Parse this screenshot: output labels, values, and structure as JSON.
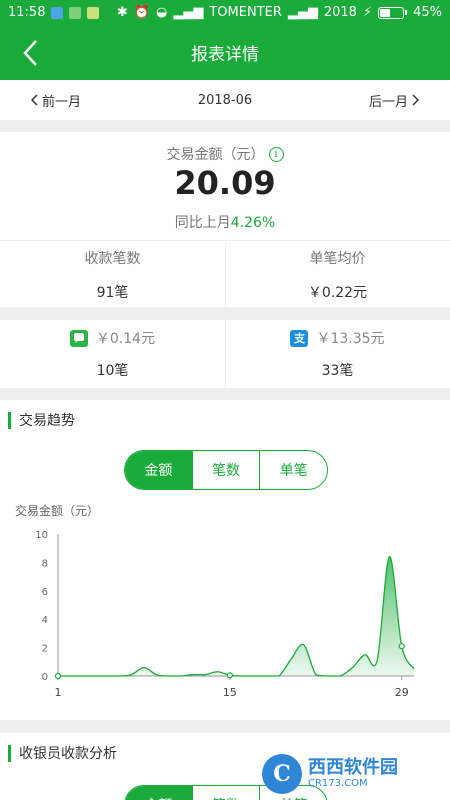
{
  "status_bar": {
    "time": "11:58",
    "carrier": "TOMENTER",
    "year_badge": "2018",
    "battery": "45%",
    "battery_level": 0.45
  },
  "header": {
    "title": "报表详情"
  },
  "month_nav": {
    "prev_label": "前一月",
    "current": "2018-06",
    "next_label": "后一月"
  },
  "summary": {
    "amount_label": "交易金额（元）",
    "amount": "20.09",
    "yoy_label": "同比上月",
    "yoy_value": "4.26%",
    "count_label": "收款笔数",
    "count_value": "91笔",
    "avg_label": "单笔均价",
    "avg_value": "￥0.22元"
  },
  "pay_split": {
    "wechat": {
      "amount": "￥0.14元",
      "count": "10笔"
    },
    "alipay": {
      "amount": "￥13.35元",
      "count": "33笔",
      "icon_char": "支"
    }
  },
  "trend": {
    "title": "交易趋势",
    "tabs": [
      "金额",
      "笔数",
      "单笔"
    ],
    "active_tab": 0,
    "chart_label": "交易金额（元）"
  },
  "cashier": {
    "title": "收银员收款分析",
    "tabs": [
      "金额",
      "笔数",
      "单笔"
    ]
  },
  "watermark": {
    "logo_char": "C",
    "name": "西西软件园",
    "domain": "CR173.COM"
  },
  "colors": {
    "brand": "#1aab3a",
    "alipay": "#1a8fe0"
  },
  "chart_data": {
    "type": "area",
    "x": [
      1,
      2,
      3,
      4,
      5,
      6,
      7,
      8,
      9,
      10,
      11,
      12,
      13,
      14,
      15,
      16,
      17,
      18,
      19,
      20,
      21,
      22,
      23,
      24,
      25,
      26,
      27,
      28,
      29,
      30
    ],
    "values": [
      0,
      0,
      0,
      0,
      0,
      0,
      0.1,
      0.6,
      0.1,
      0,
      0,
      0.1,
      0.1,
      0.3,
      0.05,
      0,
      0,
      0,
      0,
      1.2,
      2.2,
      0.1,
      0,
      0,
      0.6,
      1.5,
      1.1,
      8.4,
      2.1,
      0.5
    ],
    "x_ticks": [
      1,
      15,
      29
    ],
    "y_ticks": [
      0,
      2,
      4,
      6,
      8,
      10
    ],
    "ylim": [
      0,
      10
    ],
    "xlim": [
      1,
      30
    ],
    "ylabel": "交易金额（元）",
    "grid": false,
    "highlighted_x": [
      1,
      15,
      29
    ]
  }
}
